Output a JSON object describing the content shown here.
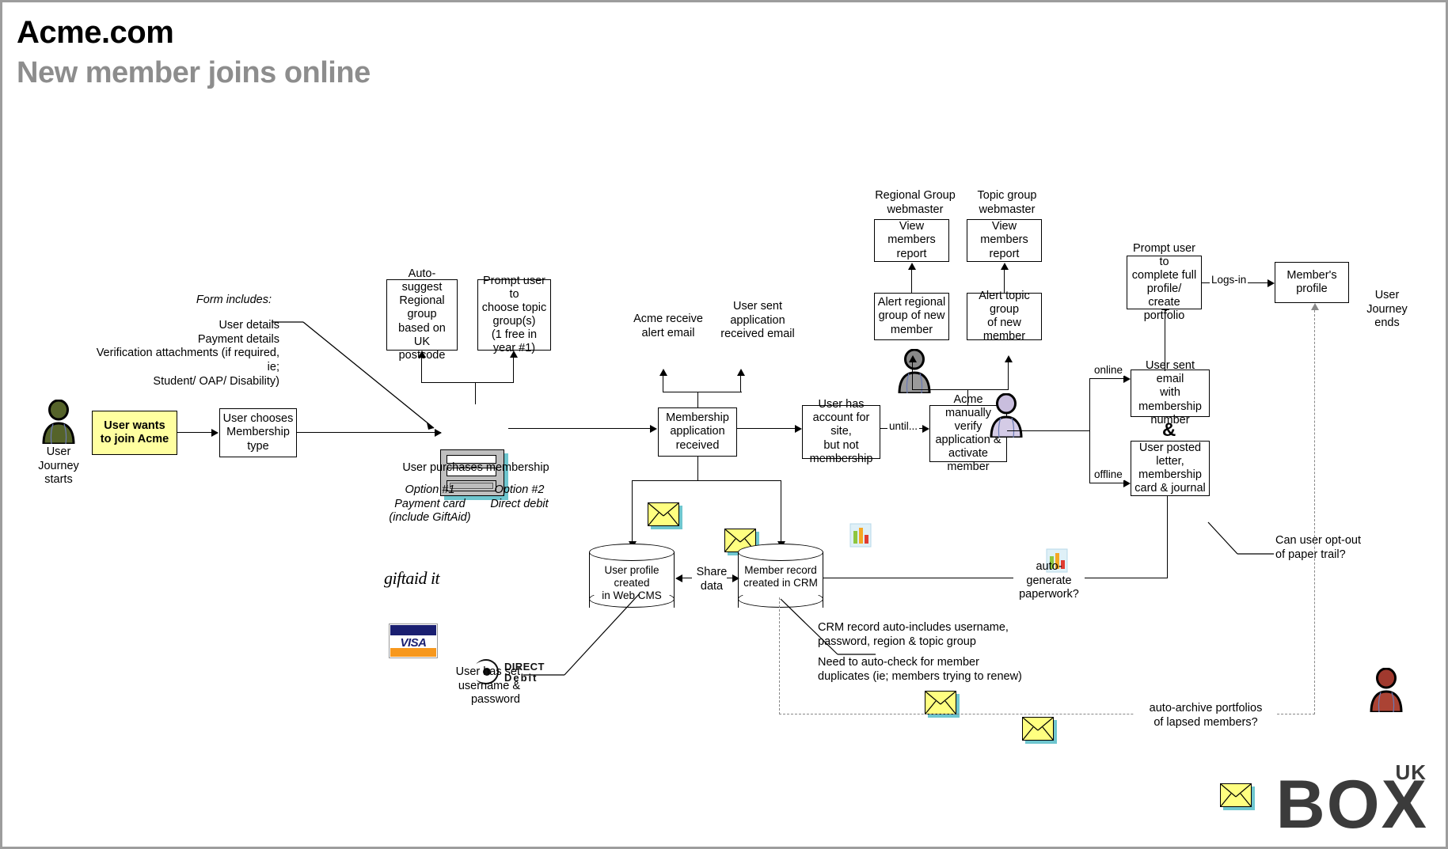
{
  "header": {
    "title": "Acme.com",
    "subtitle": "New member joins online"
  },
  "actors": {
    "start": {
      "label": "User\nJourney\nstarts",
      "color": "#55632a",
      "name": "user-journey-start"
    },
    "end": {
      "label": "User\nJourney\nends",
      "color": "#a0392e",
      "name": "user-journey-end"
    },
    "regional_webmaster": {
      "label": "Regional Group\nwebmaster",
      "color": "#8a8a8a"
    },
    "topic_webmaster": {
      "label": "Topic group\nwebmaster",
      "color": "#c9bede"
    }
  },
  "nodes": {
    "start_sticky": "User wants\nto join Acme",
    "choose_type": "User chooses\nMembership\ntype",
    "auto_suggest": "Auto-suggest\nRegional group\nbased on UK\npostcode",
    "prompt_topic": "Prompt user to\nchoose topic\ngroup(s)\n(1 free in\nyear #1)",
    "purchase_caption": "User purchases membership",
    "application_received": "Membership\napplication\nreceived",
    "account_not_membership": "User has\naccount for site,\nbut not\nmembership",
    "manual_verify": "Acme\nmanually verify\napplication &\nactivate member",
    "alert_regional": "Alert regional\ngroup of new\nmember",
    "alert_topic": "Alert topic group\nof new member",
    "view_members_report_regional": "View\nmembers report",
    "view_members_report_topic": "View\nmembers report",
    "email_membership_number": "User sent email\nwith membership\nnumber",
    "posted_letter": "User posted\nletter,\nmembership\ncard & journal",
    "prompt_full_profile": "Prompt user to\ncomplete full\nprofile/ create\nportfolio",
    "members_profile": "Member's\nprofile",
    "cms_db": "User profile created\nin Web CMS",
    "crm_db": "Member record\ncreated in CRM",
    "ampersand": "&"
  },
  "email_labels": {
    "acme_receive": "Acme receive\nalert email",
    "user_sent": "User sent\napplication\nreceived email"
  },
  "edge_labels": {
    "until": "until...",
    "online": "online",
    "offline": "offline",
    "logs_in": "Logs-in",
    "share_data": "Share\ndata",
    "auto_generate": "auto-\ngenerate\npaperwork?",
    "auto_archive": "auto-archive portfolios\nof lapsed members?"
  },
  "annotations": {
    "form_includes_title": "Form includes:",
    "form_includes_body": "User details\nPayment details\nVerification attachments (if required, ie;\nStudent/ OAP/ Disability)",
    "option1": "Option #1\nPayment card\n(include GiftAid)",
    "option2": "Option #2\nDirect debit",
    "username_password": "User has set\nusername &\npassword",
    "crm_includes": "CRM record auto-includes username,\npassword, region & topic group",
    "dup_check": "Need to auto-check for member\nduplicates (ie; members trying to renew)",
    "opt_out": "Can user opt-out\nof paper trail?"
  },
  "payment_logos": {
    "visa": "VISA",
    "direct_debit_line1": "DIRECT",
    "direct_debit_line2": "Debit",
    "giftaid": "giftaid it"
  },
  "brand": {
    "box": "BOX",
    "uk": "UK"
  },
  "colors": {
    "sticky": "#ffffa0",
    "shadow": "#6ec6cf",
    "subtitle_grey": "#8d8d8d",
    "logo_grey": "#3b3b3b"
  }
}
